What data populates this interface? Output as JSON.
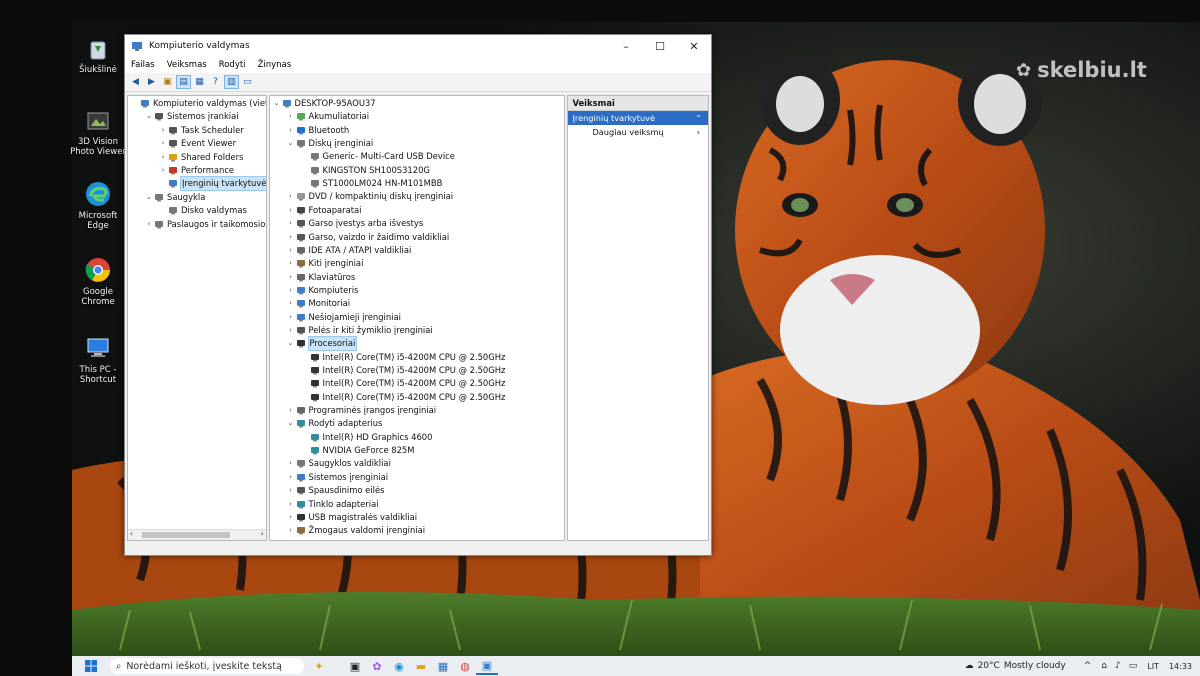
{
  "watermark": "skelbiu.lt",
  "desktop_icons": [
    {
      "label": "Šiukšlinė",
      "icon": "recycle-bin-icon"
    },
    {
      "label": "3D Vision Photo Viewer",
      "icon": "photo-viewer-icon"
    },
    {
      "label": "Microsoft Edge",
      "icon": "edge-icon"
    },
    {
      "label": "Google Chrome",
      "icon": "chrome-icon"
    },
    {
      "label": "This PC - Shortcut",
      "icon": "this-pc-icon"
    }
  ],
  "window": {
    "title": "Kompiuterio valdymas",
    "controls": [
      "–",
      "☐",
      "✕"
    ],
    "menu": [
      "Failas",
      "Veiksmas",
      "Rodyti",
      "Žinynas"
    ]
  },
  "tree": [
    {
      "label": "Kompiuterio valdymas (vietinis",
      "depth": 0,
      "expander": ""
    },
    {
      "label": "Sistemos įrankiai",
      "depth": 1,
      "expander": "v"
    },
    {
      "label": "Task Scheduler",
      "depth": 2,
      "expander": ">"
    },
    {
      "label": "Event Viewer",
      "depth": 2,
      "expander": ">"
    },
    {
      "label": "Shared Folders",
      "depth": 2,
      "expander": ">"
    },
    {
      "label": "Performance",
      "depth": 2,
      "expander": ">"
    },
    {
      "label": "Įrenginių tvarkytuvė",
      "depth": 2,
      "expander": "",
      "selected": true
    },
    {
      "label": "Saugykla",
      "depth": 1,
      "expander": "v"
    },
    {
      "label": "Disko valdymas",
      "depth": 2,
      "expander": ""
    },
    {
      "label": "Paslaugos ir taikomosios pr",
      "depth": 1,
      "expander": ">"
    }
  ],
  "devices": [
    {
      "label": "DESKTOP-95AOU37",
      "depth": 0,
      "expander": "v",
      "icon": "computer-icon"
    },
    {
      "label": "Akumuliatoriai",
      "depth": 1,
      "expander": ">",
      "icon": "battery-icon"
    },
    {
      "label": "Bluetooth",
      "depth": 1,
      "expander": ">",
      "icon": "bluetooth-icon"
    },
    {
      "label": "Diskų įrenginiai",
      "depth": 1,
      "expander": "v",
      "icon": "disk-icon"
    },
    {
      "label": "Generic- Multi-Card USB Device",
      "depth": 2,
      "expander": "",
      "icon": "disk-icon"
    },
    {
      "label": "KINGSTON SH100S3120G",
      "depth": 2,
      "expander": "",
      "icon": "disk-icon"
    },
    {
      "label": "ST1000LM024 HN-M101MBB",
      "depth": 2,
      "expander": "",
      "icon": "disk-icon"
    },
    {
      "label": "DVD / kompaktinių diskų įrenginiai",
      "depth": 1,
      "expander": ">",
      "icon": "dvd-icon"
    },
    {
      "label": "Fotoaparatai",
      "depth": 1,
      "expander": ">",
      "icon": "camera-icon"
    },
    {
      "label": "Garso įvestys arba išvestys",
      "depth": 1,
      "expander": ">",
      "icon": "speaker-icon"
    },
    {
      "label": "Garso, vaizdo ir žaidimo valdikliai",
      "depth": 1,
      "expander": ">",
      "icon": "speaker-icon"
    },
    {
      "label": "IDE ATA / ATAPI valdikliai",
      "depth": 1,
      "expander": ">",
      "icon": "controller-icon"
    },
    {
      "label": "Kiti įrenginiai",
      "depth": 1,
      "expander": ">",
      "icon": "other-device-icon"
    },
    {
      "label": "Klaviatūros",
      "depth": 1,
      "expander": ">",
      "icon": "keyboard-icon"
    },
    {
      "label": "Kompiuteris",
      "depth": 1,
      "expander": ">",
      "icon": "monitor-icon"
    },
    {
      "label": "Monitoriai",
      "depth": 1,
      "expander": ">",
      "icon": "monitor-icon"
    },
    {
      "label": "Nešiojamieji įrenginiai",
      "depth": 1,
      "expander": ">",
      "icon": "portable-device-icon"
    },
    {
      "label": "Pelės ir kiti žymiklio įrenginiai",
      "depth": 1,
      "expander": ">",
      "icon": "mouse-icon"
    },
    {
      "label": "Procesoriai",
      "depth": 1,
      "expander": "v",
      "icon": "cpu-icon",
      "selected": true
    },
    {
      "label": "Intel(R) Core(TM) i5-4200M CPU @ 2.50GHz",
      "depth": 2,
      "expander": "",
      "icon": "cpu-icon"
    },
    {
      "label": "Intel(R) Core(TM) i5-4200M CPU @ 2.50GHz",
      "depth": 2,
      "expander": "",
      "icon": "cpu-icon"
    },
    {
      "label": "Intel(R) Core(TM) i5-4200M CPU @ 2.50GHz",
      "depth": 2,
      "expander": "",
      "icon": "cpu-icon"
    },
    {
      "label": "Intel(R) Core(TM) i5-4200M CPU @ 2.50GHz",
      "depth": 2,
      "expander": "",
      "icon": "cpu-icon"
    },
    {
      "label": "Programinės įrangos įrenginiai",
      "depth": 1,
      "expander": ">",
      "icon": "software-device-icon"
    },
    {
      "label": "Rodyti adapterius",
      "depth": 1,
      "expander": "v",
      "icon": "display-adapter-icon"
    },
    {
      "label": "Intel(R) HD Graphics 4600",
      "depth": 2,
      "expander": "",
      "icon": "display-adapter-icon"
    },
    {
      "label": "NVIDIA GeForce 825M",
      "depth": 2,
      "expander": "",
      "icon": "display-adapter-icon"
    },
    {
      "label": "Saugyklos valdikliai",
      "depth": 1,
      "expander": ">",
      "icon": "storage-controller-icon"
    },
    {
      "label": "Sistemos įrenginiai",
      "depth": 1,
      "expander": ">",
      "icon": "system-device-icon"
    },
    {
      "label": "Spausdinimo eilės",
      "depth": 1,
      "expander": ">",
      "icon": "printer-icon"
    },
    {
      "label": "Tinklo adapteriai",
      "depth": 1,
      "expander": ">",
      "icon": "network-adapter-icon"
    },
    {
      "label": "USB magistralės valdikliai",
      "depth": 1,
      "expander": ">",
      "icon": "usb-icon"
    },
    {
      "label": "Žmogaus valdomi įrenginiai",
      "depth": 1,
      "expander": ">",
      "icon": "hid-icon"
    }
  ],
  "actions": {
    "header": "Veiksmai",
    "selected": "Įrenginių tvarkytuvė",
    "item": "Daugiau veiksmų"
  },
  "taskbar": {
    "search_placeholder": "Norėdami ieškoti, įveskite tekstą",
    "weather": "20°C",
    "weather_desc": "Mostly cloudy",
    "lang": "LIT",
    "time": "14:33"
  },
  "colors": {
    "selection": "#cce4f7",
    "accent": "#2b6cc4",
    "window_bg": "#f0f0f0"
  }
}
